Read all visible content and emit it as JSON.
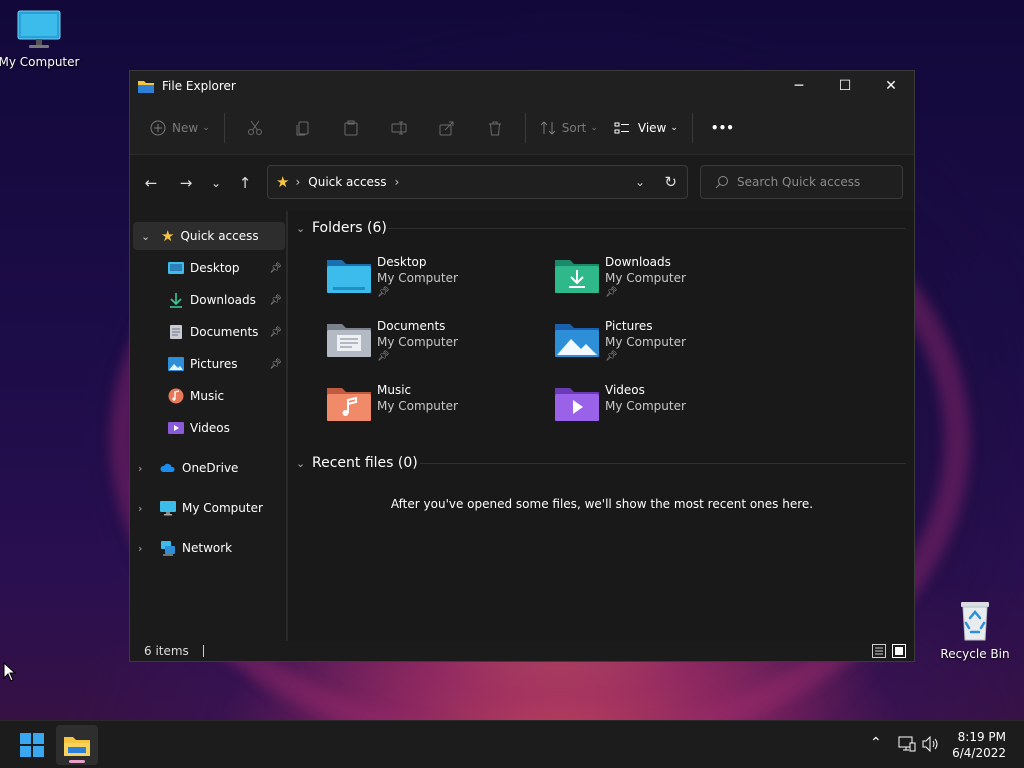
{
  "desktop": {
    "icons": [
      {
        "label": "My Computer"
      },
      {
        "label": "Recycle Bin"
      }
    ]
  },
  "window": {
    "title": "File Explorer",
    "controls": {
      "minimize": "─",
      "maximize": "☐",
      "close": "✕"
    }
  },
  "toolbar": {
    "new_label": "New",
    "sort_label": "Sort",
    "view_label": "View",
    "more_label": "•••"
  },
  "navigation": {
    "back": "←",
    "forward": "→",
    "recent": "⌄",
    "up": "↑",
    "address": {
      "location": "Quick access",
      "separator": "›"
    },
    "refresh": "↻",
    "search": {
      "placeholder": "Search Quick access"
    }
  },
  "sidebar": {
    "quick_access": {
      "label": "Quick access",
      "expanded": true
    },
    "items": [
      {
        "label": "Desktop",
        "pinned": true
      },
      {
        "label": "Downloads",
        "pinned": true
      },
      {
        "label": "Documents",
        "pinned": true
      },
      {
        "label": "Pictures",
        "pinned": true
      },
      {
        "label": "Music",
        "pinned": false
      },
      {
        "label": "Videos",
        "pinned": false
      }
    ],
    "roots": [
      {
        "label": "OneDrive"
      },
      {
        "label": "My Computer"
      },
      {
        "label": "Network"
      }
    ]
  },
  "content": {
    "folders_header": "Folders (6)",
    "folders": [
      {
        "name": "Desktop",
        "location": "My Computer",
        "pinned": true
      },
      {
        "name": "Downloads",
        "location": "My Computer",
        "pinned": true
      },
      {
        "name": "Documents",
        "location": "My Computer",
        "pinned": true
      },
      {
        "name": "Pictures",
        "location": "My Computer",
        "pinned": true
      },
      {
        "name": "Music",
        "location": "My Computer",
        "pinned": false
      },
      {
        "name": "Videos",
        "location": "My Computer",
        "pinned": false
      }
    ],
    "recent_header": "Recent files (0)",
    "recent_empty_message": "After you've opened some files, we'll show the most recent ones here."
  },
  "statusbar": {
    "item_count": "6 items"
  },
  "taskbar": {
    "time": "8:19 PM",
    "date": "6/4/2022"
  },
  "colors": {
    "accent": "#60cdff",
    "folder_yellow": "#f5c542",
    "window_bg": "#191919"
  }
}
